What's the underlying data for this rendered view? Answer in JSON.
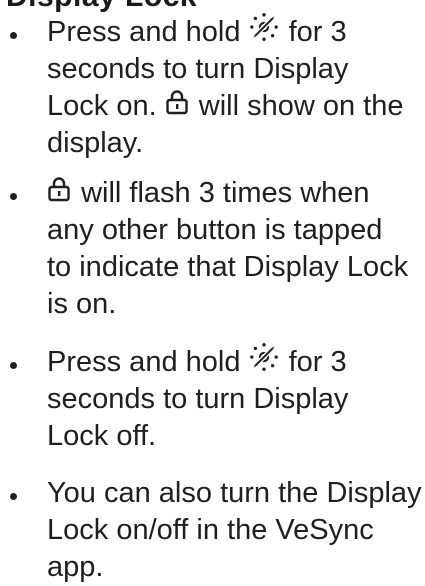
{
  "heading": {
    "visible_fragment": "Display Lock"
  },
  "icons": {
    "display_icon": "display-brightness-off-icon",
    "lock_icon": "lock-icon"
  },
  "bullets": [
    {
      "lines": [
        {
          "before": "Press and hold",
          "after": "for 3"
        },
        {
          "text": "seconds to turn Display"
        },
        {
          "before": "Lock on.",
          "after": "will show on the"
        },
        {
          "text": "display."
        }
      ]
    },
    {
      "lines": [
        {
          "after": "will flash 3 times when"
        },
        {
          "text": "any other button is tapped"
        },
        {
          "text": "to indicate that Display Lock"
        },
        {
          "text": "is on."
        }
      ]
    },
    {
      "lines": [
        {
          "before": "Press and hold",
          "after": "for 3"
        },
        {
          "text": "seconds to turn Display"
        },
        {
          "text": "Lock off."
        }
      ]
    },
    {
      "lines": [
        {
          "text": "You can also turn the Display"
        },
        {
          "text": "Lock on/off in the VeSync"
        },
        {
          "text": "app."
        }
      ]
    }
  ]
}
